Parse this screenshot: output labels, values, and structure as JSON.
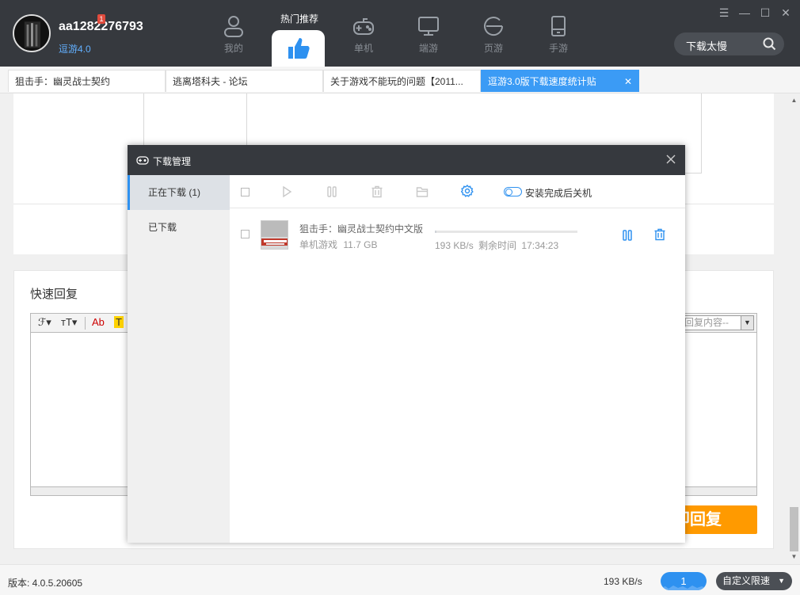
{
  "header": {
    "username": "aa1282276793",
    "notification_count": "1",
    "client_version": "逗游4.0",
    "hot_title": "热门推荐",
    "nav": [
      {
        "label": "我的",
        "icon": "user-icon"
      },
      {
        "label": "单机",
        "icon": "gamepad-icon"
      },
      {
        "label": "端游",
        "icon": "monitor-icon"
      },
      {
        "label": "页游",
        "icon": "browser-e-icon"
      },
      {
        "label": "手游",
        "icon": "phone-icon"
      }
    ],
    "search_text": "下载太慢",
    "window_controls": [
      "☰",
      "—",
      "☐",
      "✕"
    ]
  },
  "tabs": [
    {
      "label": "狙击手：幽灵战士契约",
      "active": false
    },
    {
      "label": "逃离塔科夫 - 论坛",
      "active": false
    },
    {
      "label": "关于游戏不能玩的问题【2011...",
      "active": false
    },
    {
      "label": "逗游3.0版下载速度统计贴",
      "active": true,
      "close": "✕"
    }
  ],
  "reply": {
    "title": "快速回复",
    "toolbar": {
      "font": "ℱ▾",
      "size": "ᴛT▾",
      "color": "Ab",
      "highlight": "T"
    },
    "quick_select": "回复内容--",
    "submit": "即回复"
  },
  "download_manager": {
    "title": "下载管理",
    "sidebar": [
      {
        "label": "正在下载 (1)",
        "active": true
      },
      {
        "label": "已下载",
        "active": false
      }
    ],
    "shutdown_label": "安装完成后关机",
    "item": {
      "name": "狙击手：幽灵战士契约中文版",
      "category": "单机游戏",
      "size": "11.7 GB",
      "speed": "193 KB/s",
      "remaining_label": "剩余时间",
      "remaining": "17:34:23",
      "progress": 0.01
    }
  },
  "statusbar": {
    "version": "版本: 4.0.5.20605",
    "speed": "193 KB/s",
    "download_count": "1",
    "limit_label": "自定义限速",
    "limit_arrow": "▼"
  },
  "colors": {
    "accent": "#2e91f0",
    "topbar": "#36393e",
    "submit": "#ff9a00"
  }
}
